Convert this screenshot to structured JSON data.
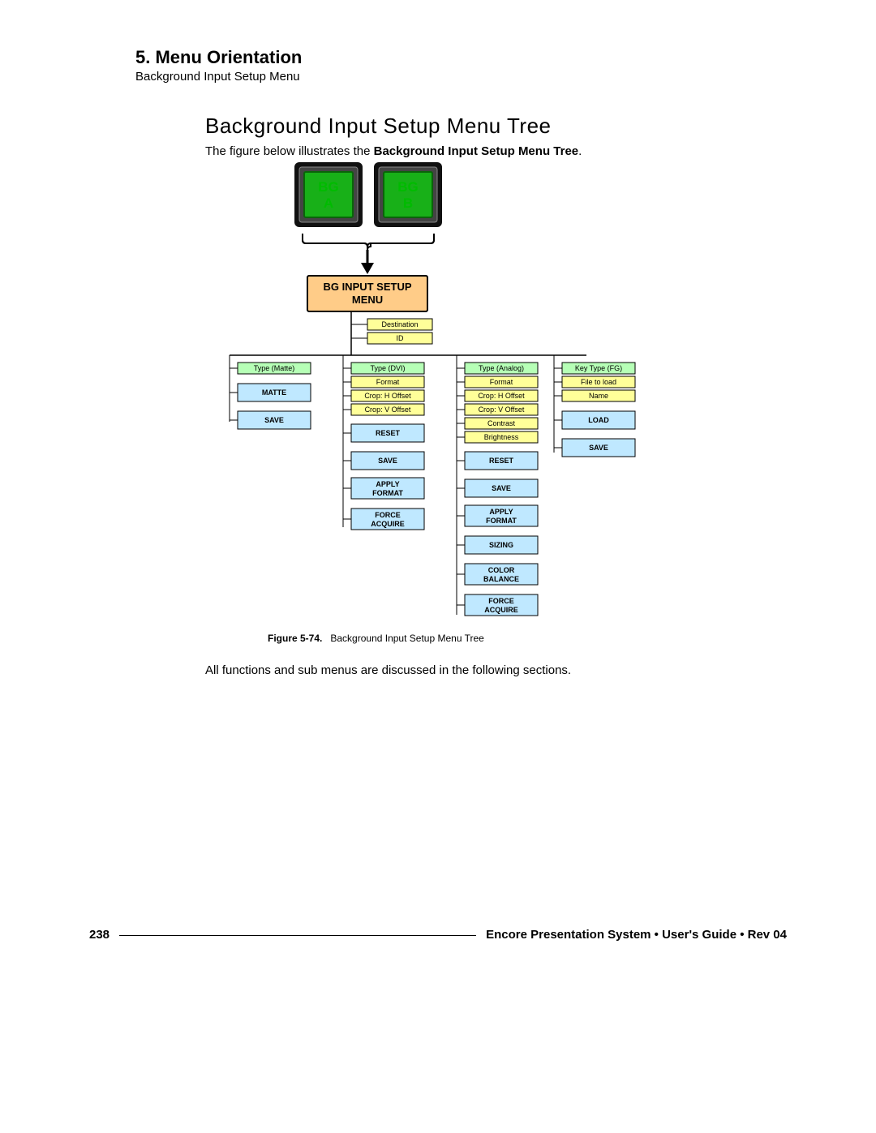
{
  "header": {
    "section": "5.  Menu Orientation",
    "subtitle": "Background Input Setup Menu"
  },
  "title": "Background Input Setup Menu Tree",
  "intro_pre": "The figure below illustrates the ",
  "intro_bold": "Background Input Setup Menu Tree",
  "intro_post": ".",
  "caption": {
    "fig": "Figure 5-74.",
    "text": "Background Input Setup Menu Tree"
  },
  "outro": "All functions and sub menus are discussed in the following sections.",
  "footer": {
    "page": "238",
    "doc": "Encore Presentation System  •  User's Guide  •  Rev 04"
  },
  "tree": {
    "buttons": {
      "a": {
        "l1": "BG",
        "l2": "A"
      },
      "b": {
        "l1": "BG",
        "l2": "B"
      }
    },
    "root": "BG INPUT SETUP MENU",
    "root_l1": "BG INPUT SETUP",
    "root_l2": "MENU",
    "top_yellow": [
      "Destination",
      "ID"
    ],
    "cols": {
      "matte": {
        "green": "Type (Matte)",
        "blue": [
          "MATTE",
          "SAVE"
        ]
      },
      "dvi": {
        "green": "Type (DVI)",
        "yellow": [
          "Format",
          "Crop:  H Offset",
          "Crop:  V Offset"
        ],
        "blue": [
          "RESET",
          "SAVE",
          "APPLY FORMAT",
          "FORCE ACQUIRE"
        ]
      },
      "analog": {
        "green": "Type (Analog)",
        "yellow": [
          "Format",
          "Crop:  H Offset",
          "Crop:  V Offset",
          "Contrast",
          "Brightness"
        ],
        "blue": [
          "RESET",
          "SAVE",
          "APPLY FORMAT",
          "SIZING",
          "COLOR BALANCE",
          "FORCE ACQUIRE"
        ]
      },
      "key": {
        "green": "Key Type (FG)",
        "yellow": [
          "File to load",
          "Name"
        ],
        "blue": [
          "LOAD",
          "SAVE"
        ]
      }
    }
  }
}
